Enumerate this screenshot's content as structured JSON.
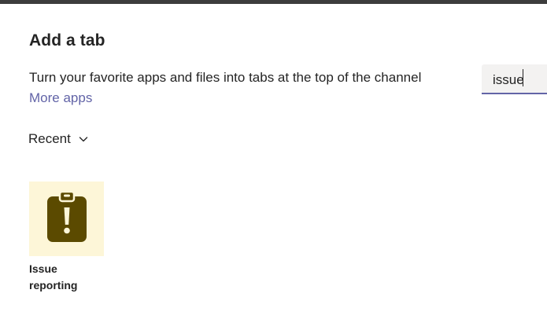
{
  "dialog": {
    "title": "Add a tab",
    "subtitle": "Turn your favorite apps and files into tabs at the top of the channel",
    "more_apps_label": "More apps"
  },
  "search": {
    "value": "issue"
  },
  "filter": {
    "label": "Recent",
    "icon": "chevron-down-icon"
  },
  "apps": [
    {
      "name": "Issue reporting",
      "icon": "clipboard-alert-icon",
      "icon_bg_color": "#fdf6d8",
      "icon_color": "#5b4a00"
    }
  ],
  "colors": {
    "accent": "#6264a7",
    "text": "#242424"
  }
}
